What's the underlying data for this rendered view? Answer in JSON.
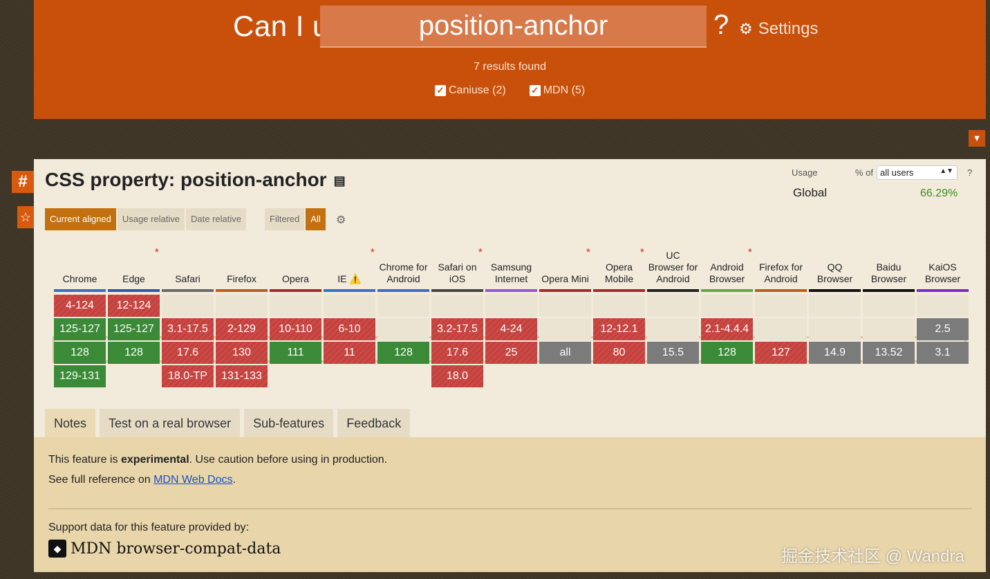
{
  "header": {
    "prefix": "Can I use",
    "query": "position-anchor",
    "help": "?",
    "settings_label": "Settings",
    "results": "7 results found",
    "filters": [
      {
        "label": "Caniuse (2)",
        "checked": true
      },
      {
        "label": "MDN (5)",
        "checked": true
      }
    ]
  },
  "side": {
    "hash": "#",
    "star": "☆"
  },
  "feature": {
    "title": "CSS property: position-anchor"
  },
  "usage": {
    "label": "Usage",
    "pct_of": "% of",
    "select_value": "all users",
    "help": "?",
    "global_label": "Global",
    "global_value": "66.29%"
  },
  "view_tabs": [
    "Current aligned",
    "Usage relative",
    "Date relative"
  ],
  "filter_tabs": [
    "Filtered",
    "All"
  ],
  "browsers": [
    {
      "name": "Chrome",
      "bar": "#3b6fc7",
      "note": false,
      "cells": [
        [
          "4-124",
          "n"
        ],
        [
          "125-127",
          "y"
        ],
        [
          "128",
          "y"
        ],
        [
          "129-131",
          "y"
        ]
      ]
    },
    {
      "name": "Edge",
      "bar": "#2b5aa8",
      "note": true,
      "cells": [
        [
          "12-124",
          "n"
        ],
        [
          "125-127",
          "y"
        ],
        [
          "128",
          "y"
        ],
        [
          "",
          "none"
        ]
      ]
    },
    {
      "name": "Safari",
      "bar": "#6a6a6a",
      "note": false,
      "cells": [
        [
          "",
          "e"
        ],
        [
          "3.1-17.5",
          "n"
        ],
        [
          "17.6",
          "n"
        ],
        [
          "18.0-TP",
          "n"
        ]
      ]
    },
    {
      "name": "Firefox",
      "bar": "#b8601a",
      "note": false,
      "cells": [
        [
          "",
          "e"
        ],
        [
          "2-129",
          "n"
        ],
        [
          "130",
          "n"
        ],
        [
          "131-133",
          "n"
        ]
      ]
    },
    {
      "name": "Opera",
      "bar": "#a52a2a",
      "note": false,
      "cells": [
        [
          "",
          "e"
        ],
        [
          "10-110",
          "n"
        ],
        [
          "111",
          "y"
        ],
        [
          "",
          "none"
        ]
      ]
    },
    {
      "name": "IE ⚠️",
      "bar": "#3b6fc7",
      "note": true,
      "cells": [
        [
          "",
          "e"
        ],
        [
          "6-10",
          "n"
        ],
        [
          "11",
          "n"
        ],
        [
          "",
          "none"
        ]
      ]
    },
    {
      "name": "Chrome for Android",
      "bar": "#3b6fc7",
      "note": false,
      "cells": [
        [
          "",
          "e"
        ],
        [
          "",
          "e"
        ],
        [
          "128",
          "y"
        ],
        [
          "",
          "none"
        ]
      ]
    },
    {
      "name": "Safari on iOS",
      "bar": "#444444",
      "note": true,
      "cells": [
        [
          "",
          "e"
        ],
        [
          "3.2-17.5",
          "n"
        ],
        [
          "17.6",
          "n"
        ],
        [
          "18.0",
          "n"
        ]
      ]
    },
    {
      "name": "Samsung Internet",
      "bar": "#8e5ad6",
      "note": false,
      "cells": [
        [
          "",
          "e"
        ],
        [
          "4-24",
          "n"
        ],
        [
          "25",
          "n"
        ],
        [
          "",
          "none"
        ]
      ]
    },
    {
      "name": "Opera Mini",
      "bar": "#a52a2a",
      "note": true,
      "cells": [
        [
          "",
          "e"
        ],
        [
          "",
          "e"
        ],
        [
          "all",
          "u"
        ],
        [
          "",
          "none"
        ]
      ]
    },
    {
      "name": "Opera Mobile",
      "bar": "#a52a2a",
      "note": true,
      "cells": [
        [
          "",
          "e"
        ],
        [
          "12-12.1",
          "n"
        ],
        [
          "80",
          "n"
        ],
        [
          "",
          "none"
        ]
      ]
    },
    {
      "name": "UC Browser for Android",
      "bar": "#222222",
      "note": false,
      "cells": [
        [
          "",
          "e"
        ],
        [
          "",
          "e"
        ],
        [
          "15.5",
          "u"
        ],
        [
          "",
          "none"
        ]
      ]
    },
    {
      "name": "Android Browser",
      "bar": "#6aa34a",
      "note": true,
      "cells": [
        [
          "",
          "e"
        ],
        [
          "2.1-4.4.4",
          "n"
        ],
        [
          "128",
          "y"
        ],
        [
          "",
          "none"
        ]
      ]
    },
    {
      "name": "Firefox for Android",
      "bar": "#b8601a",
      "note": false,
      "cells": [
        [
          "",
          "e"
        ],
        [
          "",
          "e"
        ],
        [
          "127",
          "n"
        ],
        [
          "",
          "none"
        ]
      ]
    },
    {
      "name": "QQ Browser",
      "bar": "#111111",
      "note": false,
      "cells": [
        [
          "",
          "e"
        ],
        [
          "",
          "e"
        ],
        [
          "14.9",
          "u"
        ],
        [
          "",
          "none"
        ]
      ]
    },
    {
      "name": "Baidu Browser",
      "bar": "#111111",
      "note": false,
      "cells": [
        [
          "",
          "e"
        ],
        [
          "",
          "e"
        ],
        [
          "13.52",
          "u"
        ],
        [
          "",
          "none"
        ]
      ]
    },
    {
      "name": "KaiOS Browser",
      "bar": "#7a2bc9",
      "note": false,
      "cells": [
        [
          "",
          "e"
        ],
        [
          "2.5",
          "u"
        ],
        [
          "3.1",
          "u"
        ],
        [
          "",
          "none"
        ]
      ]
    }
  ],
  "bottom_tabs": [
    "Notes",
    "Test on a real browser",
    "Sub-features",
    "Feedback"
  ],
  "notes": {
    "line1_pre": "This feature is ",
    "line1_bold": "experimental",
    "line1_post": ". Use caution before using in production.",
    "line2_pre": "See full reference on ",
    "line2_link": "MDN Web Docs",
    "line2_post": ".",
    "support_by": "Support data for this feature provided by:",
    "provider": "MDN browser-compat-data"
  },
  "watermark": "掘金技术社区 @ Wandra"
}
